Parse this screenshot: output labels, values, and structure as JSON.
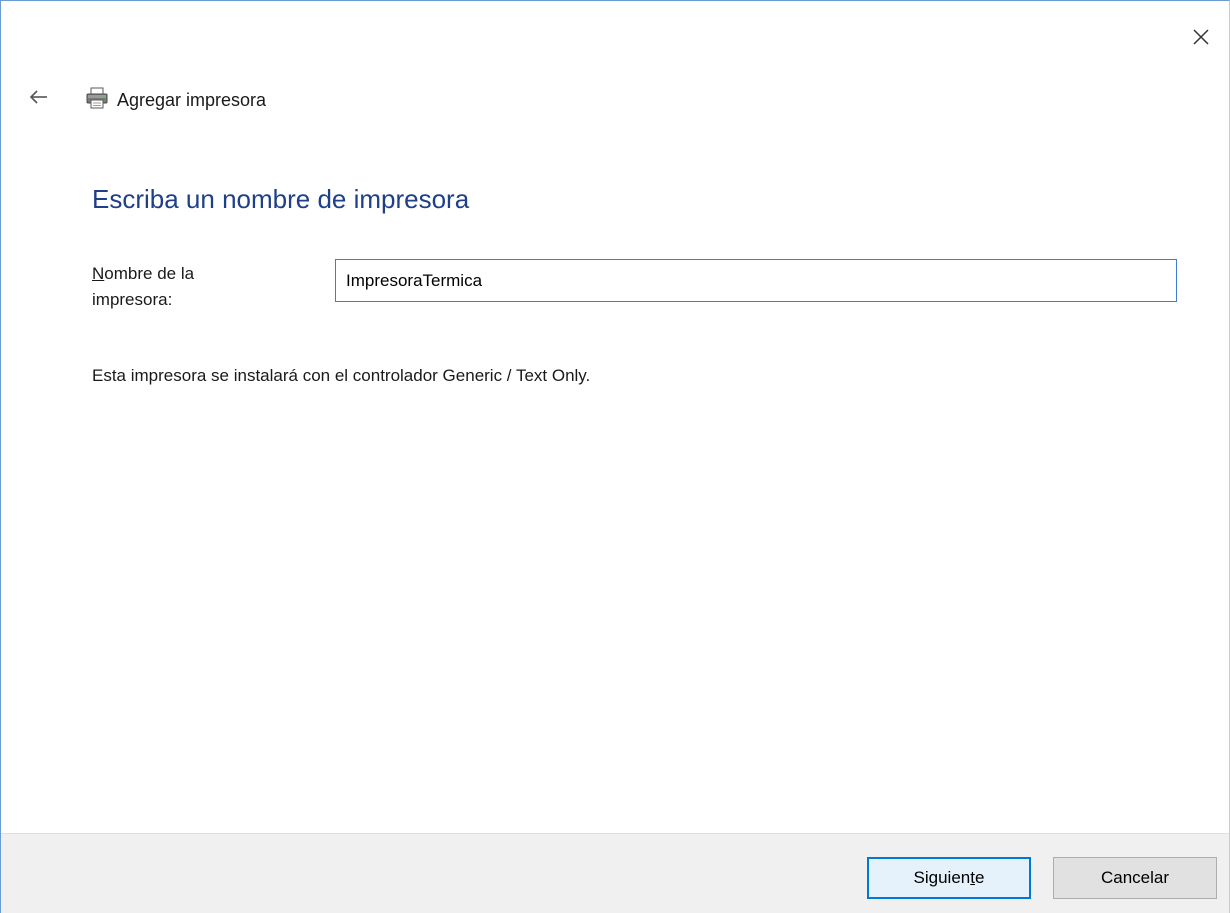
{
  "window": {
    "title": "Agregar impresora",
    "close_icon": "close-icon",
    "back_icon": "back-arrow-icon",
    "printer_icon": "printer-icon"
  },
  "content": {
    "heading": "Escriba un nombre de impresora",
    "field_label_line1_rest": "ombre de la",
    "field_label_mnemonic": "N",
    "field_label_line2": "impresora:",
    "printer_name_value": "ImpresoraTermica",
    "driver_info": "Esta impresora se instalará con el controlador Generic / Text Only."
  },
  "footer": {
    "next_label_pre": "Siguien",
    "next_label_mnemonic": "t",
    "next_label_post": "e",
    "cancel_label": "Cancelar"
  },
  "colors": {
    "heading": "#1e3f8a",
    "accent": "#0078d7",
    "footer_bg": "#f0f0f0"
  }
}
